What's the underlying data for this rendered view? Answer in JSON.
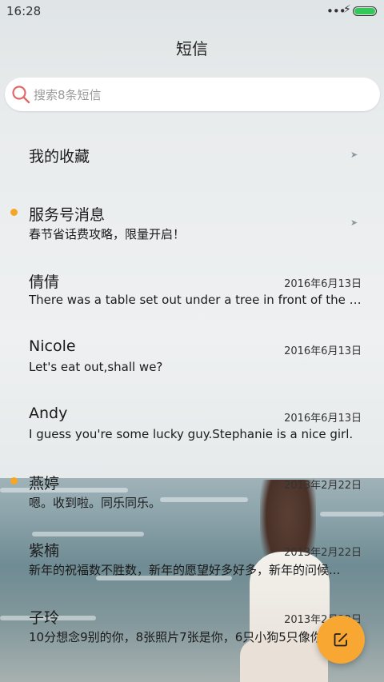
{
  "status_bar": {
    "time": "16:28",
    "signal_dots": "•••",
    "charging": "⚡",
    "battery_color": "#34c759"
  },
  "header": {
    "title": "短信"
  },
  "search": {
    "placeholder": "搜索8条短信"
  },
  "colors": {
    "accent": "#f7a732",
    "unread_dot": "#f5a623"
  },
  "conversations": [
    {
      "name": "我的收藏",
      "date": "",
      "preview": "",
      "unread": false,
      "arrow": true
    },
    {
      "name": "服务号消息",
      "date": "",
      "preview": "春节省话费攻略，限量开启！",
      "unread": true,
      "arrow": true
    },
    {
      "name": "倩倩",
      "date": "2016年6月13日",
      "preview": "There was a table set out under a tree in front of the ho...",
      "unread": false,
      "arrow": false
    },
    {
      "name": "Nicole",
      "date": "2016年6月13日",
      "preview": "Let's eat out,shall we?",
      "unread": false,
      "arrow": false
    },
    {
      "name": "Andy",
      "date": "2016年6月13日",
      "preview": "I guess you're some lucky guy.Stephanie is a nice girl.",
      "unread": false,
      "arrow": false
    },
    {
      "name": "燕婷",
      "date": "2013年2月22日",
      "preview": "嗯。收到啦。同乐同乐。",
      "unread": true,
      "arrow": false
    },
    {
      "name": "紫楠",
      "date": "2013年2月22日",
      "preview": "新年的祝福数不胜数，新年的愿望好多好多，新年的问候...",
      "unread": false,
      "arrow": false
    },
    {
      "name": "子玲",
      "date": "2013年2月22日",
      "preview": "10分想念9别的你，8张照片7张是你，6只小狗5只像你",
      "unread": false,
      "arrow": false
    }
  ],
  "fab": {
    "icon": "compose-icon"
  }
}
